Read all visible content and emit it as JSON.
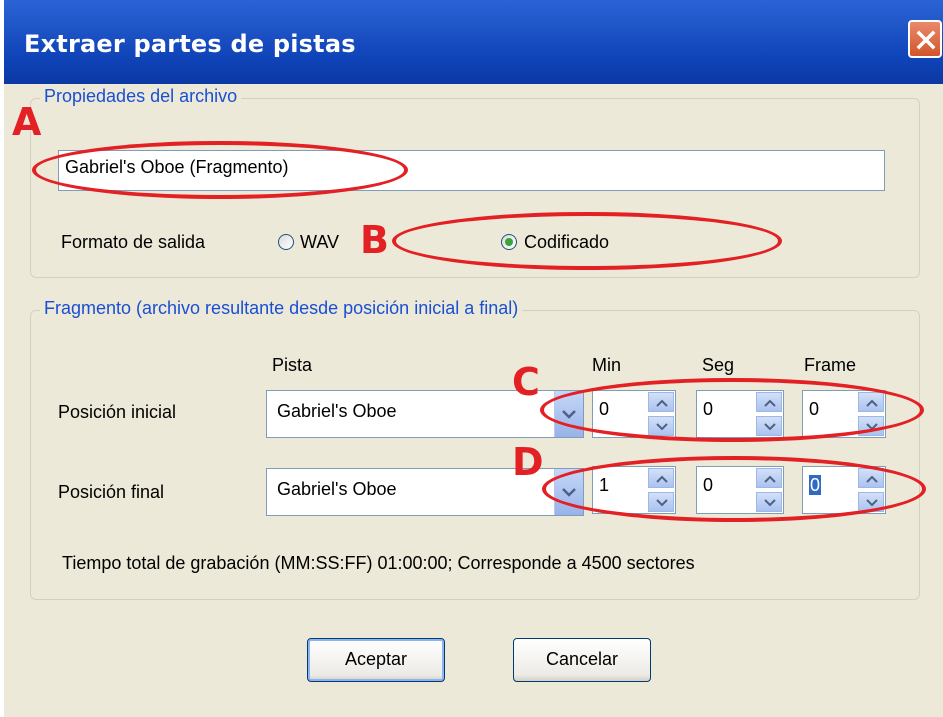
{
  "window": {
    "title": "Extraer partes de pistas",
    "close_icon": "close-icon"
  },
  "file_props": {
    "legend": "Propiedades del archivo",
    "name_value": "Gabriel's Oboe (Fragmento)",
    "format_label": "Formato de salida",
    "options": [
      {
        "label": "WAV",
        "selected": false
      },
      {
        "label": "Codificado",
        "selected": true
      }
    ]
  },
  "fragment": {
    "legend": "Fragmento (archivo resultante desde posición inicial a final)",
    "col_track": "Pista",
    "col_min": "Min",
    "col_sec": "Seg",
    "col_frame": "Frame",
    "start": {
      "label": "Posición inicial",
      "track": "Gabriel's Oboe",
      "min": "0",
      "sec": "0",
      "frame": "0"
    },
    "end": {
      "label": "Posición final",
      "track": "Gabriel's Oboe",
      "min": "1",
      "sec": "0",
      "frame": "0"
    },
    "total": "Tiempo total de grabación (MM:SS:FF) 01:00:00; Corresponde a 4500 sectores"
  },
  "buttons": {
    "ok": "Aceptar",
    "cancel": "Cancelar"
  },
  "annotations": {
    "a": "A",
    "b": "B",
    "c": "C",
    "d": "D",
    "color": "#e32024"
  }
}
